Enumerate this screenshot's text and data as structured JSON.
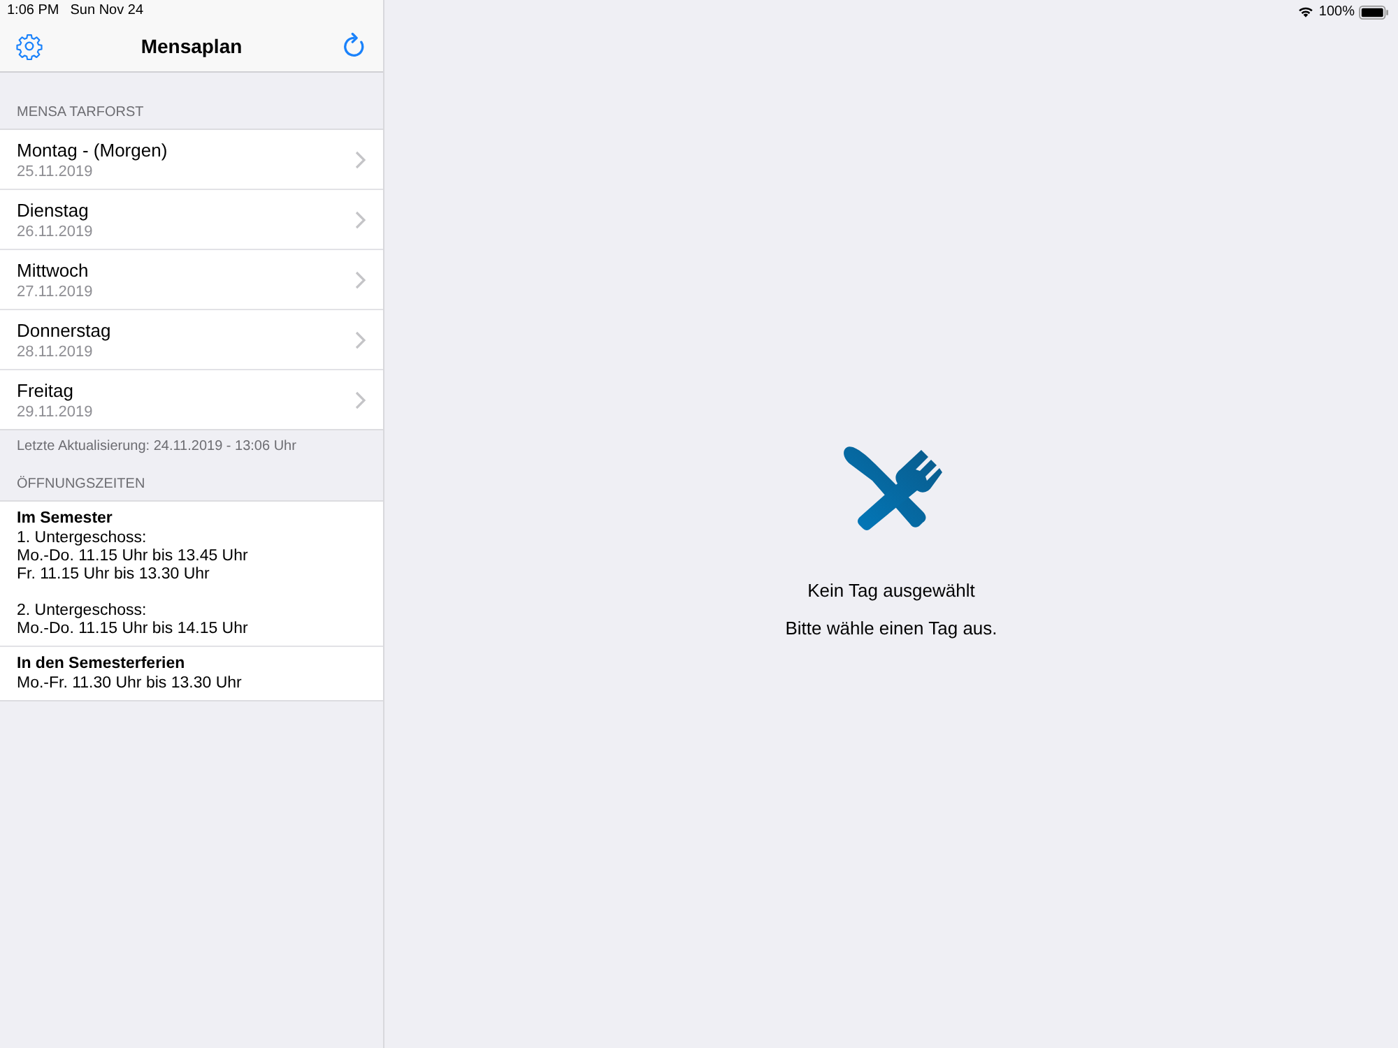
{
  "status_bar": {
    "time": "1:06 PM",
    "date": "Sun Nov 24",
    "battery": "100%"
  },
  "nav_bar": {
    "title": "Mensaplan"
  },
  "menu_section": {
    "header": "MENSA TARFORST",
    "days": [
      {
        "title": "Montag - (Morgen)",
        "date": "25.11.2019"
      },
      {
        "title": "Dienstag",
        "date": "26.11.2019"
      },
      {
        "title": "Mittwoch",
        "date": "27.11.2019"
      },
      {
        "title": "Donnerstag",
        "date": "28.11.2019"
      },
      {
        "title": "Freitag",
        "date": "29.11.2019"
      }
    ],
    "footer": "Letzte Aktualisierung: 24.11.2019 - 13:06 Uhr"
  },
  "hours_section": {
    "header": "ÖFFNUNGSZEITEN",
    "blocks": [
      {
        "title": "Im Semester",
        "paragraphs": [
          {
            "lines": [
              "1. Untergeschoss:",
              "Mo.-Do. 11.15 Uhr bis 13.45 Uhr",
              "Fr. 11.15 Uhr bis 13.30 Uhr"
            ]
          },
          {
            "lines": [
              "2. Untergeschoss:",
              "Mo.-Do. 11.15 Uhr bis 14.15 Uhr"
            ]
          }
        ]
      },
      {
        "title": "In den Semesterferien",
        "paragraphs": [
          {
            "lines": [
              "Mo.-Fr. 11.30 Uhr bis 13.30 Uhr"
            ]
          }
        ]
      }
    ]
  },
  "empty_state": {
    "title": "Kein Tag ausgewählt",
    "message": "Bitte wähle einen Tag aus."
  }
}
